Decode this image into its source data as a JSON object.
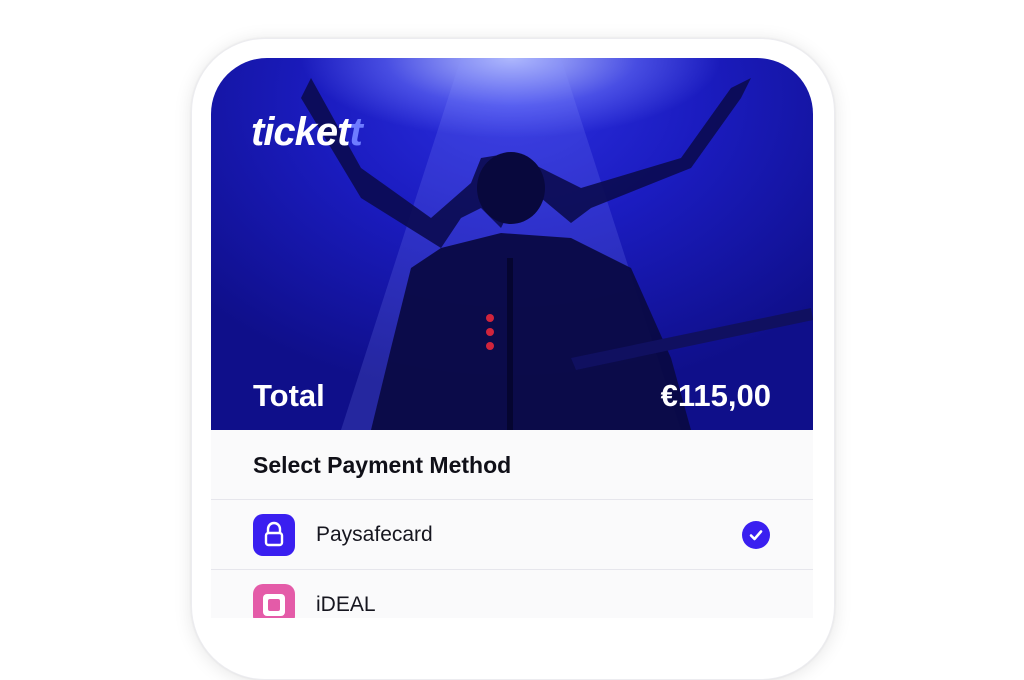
{
  "brand": {
    "logo_main": "ticket",
    "logo_accent": "t"
  },
  "summary": {
    "label": "Total",
    "amount": "€115,00"
  },
  "payment": {
    "title": "Select Payment Method",
    "methods": [
      {
        "label": "Paysafecard",
        "icon": "lock-icon",
        "color": "#3a1ff0",
        "selected": true
      },
      {
        "label": "iDEAL",
        "icon": "ideal-icon",
        "color": "#e45ba8",
        "selected": false
      }
    ]
  },
  "colors": {
    "accent": "#3a1ff0",
    "hero": "#1b1cc0"
  }
}
